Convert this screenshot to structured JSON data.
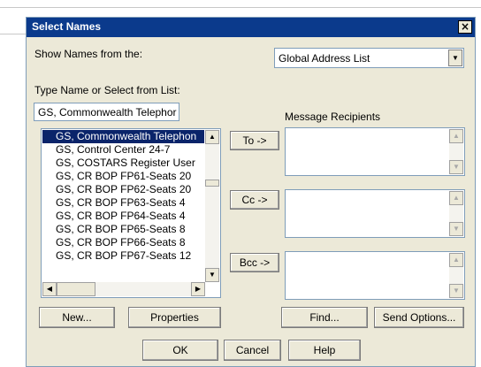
{
  "dialog": {
    "title": "Select Names",
    "close_glyph": "×"
  },
  "show_names": {
    "label": "Show Names from the:",
    "value": "Global Address List"
  },
  "type_name": {
    "label": "Type Name or Select from List:",
    "value": "GS, Commonwealth Telephor"
  },
  "recipients_header": "Message Recipients",
  "names_list": [
    {
      "text": "GS, Commonwealth Telephon",
      "selected": true
    },
    {
      "text": "GS, Control Center 24-7",
      "selected": false
    },
    {
      "text": "GS, COSTARS Register User",
      "selected": false
    },
    {
      "text": "GS, CR BOP FP61-Seats 20",
      "selected": false
    },
    {
      "text": "GS, CR BOP FP62-Seats 20",
      "selected": false
    },
    {
      "text": "GS, CR BOP FP63-Seats 4",
      "selected": false
    },
    {
      "text": "GS, CR BOP FP64-Seats 4",
      "selected": false
    },
    {
      "text": "GS, CR BOP FP65-Seats 8",
      "selected": false
    },
    {
      "text": "GS, CR BOP FP66-Seats 8",
      "selected": false
    },
    {
      "text": "GS, CR BOP FP67-Seats 12",
      "selected": false
    }
  ],
  "buttons": {
    "to": "To ->",
    "cc": "Cc ->",
    "bcc": "Bcc ->",
    "new": "New...",
    "properties": "Properties",
    "find": "Find...",
    "send_options": "Send Options...",
    "ok": "OK",
    "cancel": "Cancel",
    "help": "Help"
  },
  "colors": {
    "title_bar": "#0b3a8c",
    "selection": "#0a246a",
    "dialog_face": "#ece9d8"
  }
}
